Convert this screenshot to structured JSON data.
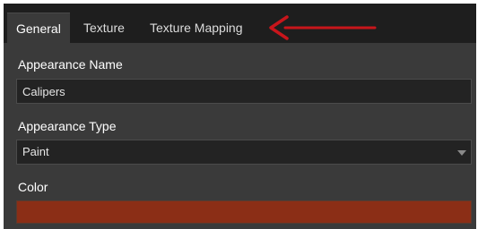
{
  "tabs": [
    {
      "label": "General",
      "active": true
    },
    {
      "label": "Texture",
      "active": false
    },
    {
      "label": "Texture Mapping",
      "active": false
    }
  ],
  "appearance_name": {
    "label": "Appearance Name",
    "value": "Calipers"
  },
  "appearance_type": {
    "label": "Appearance Type",
    "value": "Paint"
  },
  "color": {
    "label": "Color",
    "value": "#8b2e16"
  },
  "annotation": {
    "arrow_color": "#c8151b"
  }
}
